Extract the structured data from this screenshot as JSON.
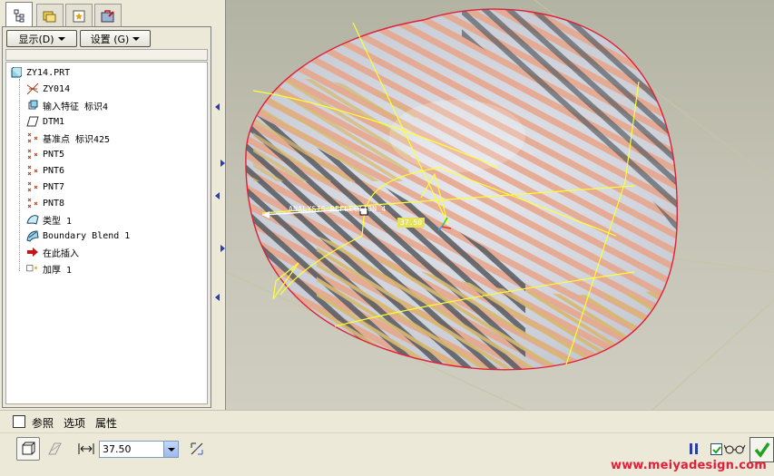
{
  "tree_toolbar": {
    "show_label": "显示",
    "show_mnemonic": "(D)",
    "settings_label": "设置",
    "settings_mnemonic": "(G)"
  },
  "model_tree": [
    {
      "label": "ZY14.PRT",
      "icon": "part-icon"
    },
    {
      "label": "ZY014",
      "icon": "csys-icon"
    },
    {
      "label": "输入特征 标识4",
      "icon": "import-feature-icon"
    },
    {
      "label": "DTM1",
      "icon": "datum-plane-icon"
    },
    {
      "label": "基准点 标识425",
      "icon": "datum-point-icon"
    },
    {
      "label": "PNT5",
      "icon": "datum-point-icon"
    },
    {
      "label": "PNT6",
      "icon": "datum-point-icon"
    },
    {
      "label": "PNT7",
      "icon": "datum-point-icon"
    },
    {
      "label": "PNT8",
      "icon": "datum-point-icon"
    },
    {
      "label": "类型 1",
      "icon": "style-surface-icon"
    },
    {
      "label": "Boundary Blend 1",
      "icon": "boundary-blend-icon"
    },
    {
      "label": "在此插入",
      "icon": "insert-here-arrow-icon"
    },
    {
      "label": "加厚 1",
      "icon": "thicken-icon"
    }
  ],
  "viewport": {
    "analysis_label": "ANALYSIS_REFLECTION_4",
    "dimension_value": "37.50",
    "colors": {
      "surface_base": "#c9cdd6",
      "stripe_dark": "#555b60",
      "stripe_warm": "#e8a488",
      "edge": "#e0203a",
      "datum": "#ffff33"
    }
  },
  "slide_tabs": {
    "references": "参照",
    "options": "选项",
    "properties": "属性"
  },
  "dashboard": {
    "thickness_value": "37.50"
  },
  "watermark": "www.meiyadesign.com"
}
